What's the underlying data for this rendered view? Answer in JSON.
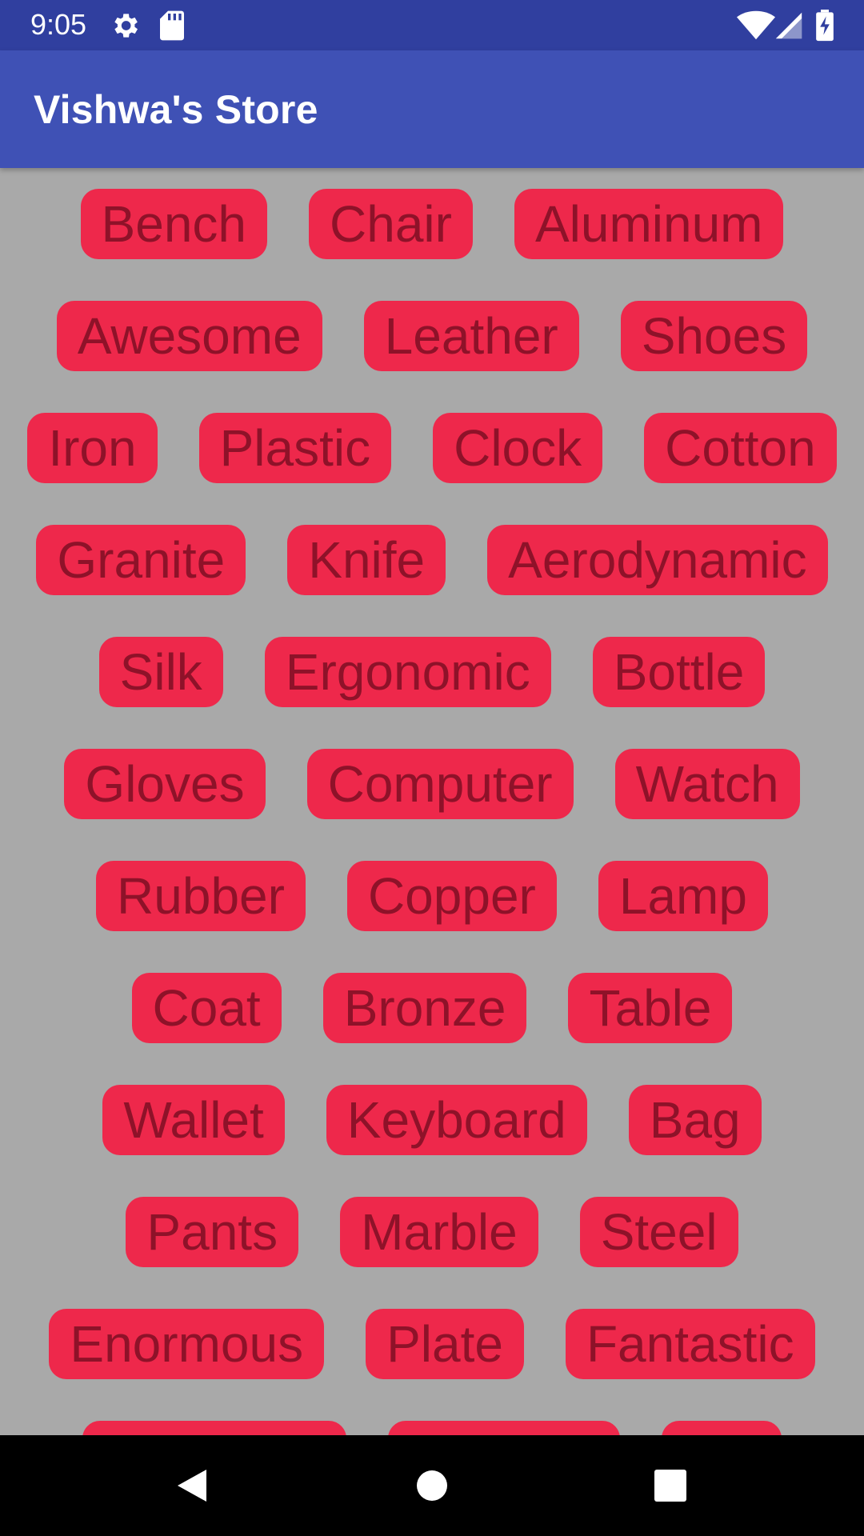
{
  "status_bar": {
    "time": "9:05",
    "icons": [
      "gear-icon",
      "sd-card-icon",
      "wifi-icon",
      "signal-icon",
      "battery-charging-icon"
    ]
  },
  "app_bar": {
    "title": "Vishwa's Store",
    "color": "#3f51b5"
  },
  "tag_style": {
    "background": "#ee284b",
    "text_color": "#8e1229"
  },
  "tags": [
    [
      "Bench",
      "Chair",
      "Aluminum"
    ],
    [
      "Awesome",
      "Leather",
      "Shoes"
    ],
    [
      "Iron",
      "Plastic",
      "Clock",
      "Cotton"
    ],
    [
      "Granite",
      "Knife",
      "Aerodynamic"
    ],
    [
      "Silk",
      "Ergonomic",
      "Bottle"
    ],
    [
      "Gloves",
      "Computer",
      "Watch"
    ],
    [
      "Rubber",
      "Copper",
      "Lamp"
    ],
    [
      "Coat",
      "Bronze",
      "Table"
    ],
    [
      "Wallet",
      "Keyboard",
      "Bag"
    ],
    [
      "Pants",
      "Marble",
      "Steel"
    ],
    [
      "Enormous",
      "Plate",
      "Fantastic"
    ]
  ],
  "nav_bar": {
    "buttons": [
      "back-icon",
      "home-icon",
      "recents-icon"
    ]
  }
}
